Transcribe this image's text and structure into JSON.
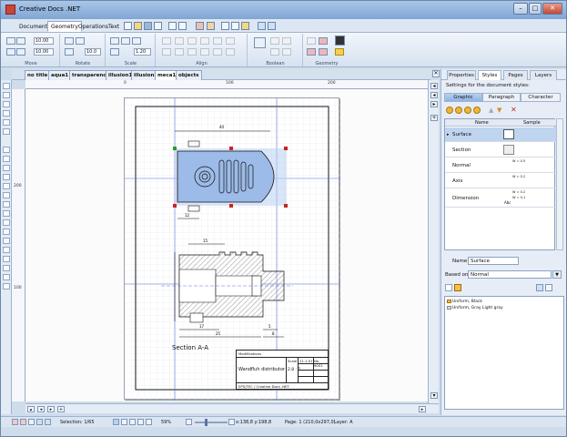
{
  "app": {
    "title": "Creative Docs .NET"
  },
  "titlebar": {
    "minimize": "–",
    "maximize": "□",
    "close": "✕"
  },
  "menu_tabs": [
    "Documents",
    "Geometry",
    "Operations",
    "Text"
  ],
  "ribbon": {
    "groups": [
      "Move",
      "Rotate",
      "Scale",
      "Align",
      "Boolean",
      "Geometry"
    ],
    "move_x": "10.00",
    "move_y": "10.00",
    "rotate_val": "10.0",
    "scale_val": "1.20"
  },
  "doc_tabs": [
    "no title",
    "aqua1",
    "transparency",
    "illusion1",
    "illusion2",
    "meca1",
    "objects"
  ],
  "ruler": {
    "top": [
      "0",
      "100",
      "200"
    ],
    "left": [
      "200",
      "100"
    ]
  },
  "drawing": {
    "dims": [
      "40",
      "12",
      "15",
      "17",
      "25",
      "5",
      "8"
    ],
    "section_label": "Section A-A",
    "title_block": {
      "modifications": "Modifications",
      "name": "Wandfluh distributor",
      "scale_label": "Scale",
      "scale_val": "2.8 : 1",
      "company": "EPS/TEC / Creative Docs .NET",
      "date": "21.1.01",
      "no": "No 9001"
    }
  },
  "panel": {
    "tabs": [
      "Properties",
      "Styles",
      "Pages",
      "Layers"
    ],
    "settings_title": "Settings for the document styles:",
    "subtabs": [
      "Graphic",
      "Paragraph",
      "Character"
    ],
    "grid_headers": [
      "Name",
      "Sample"
    ],
    "styles": [
      {
        "name": "Surface"
      },
      {
        "name": "Section"
      },
      {
        "name": "Normal",
        "sample": "W = 0.5"
      },
      {
        "name": "Axis",
        "sample": "W = 0.2"
      },
      {
        "name": "Dimension",
        "sample": "W = 0.2",
        "sample2": "W = 0.1",
        "sample3": "Abc"
      }
    ],
    "name_label": "Name",
    "name_value": "Surface",
    "based_on_label": "Based on",
    "based_on_value": "Normal",
    "descriptions": [
      "Uniform, Black",
      "Uniform, Gray Light gray"
    ]
  },
  "status": {
    "selection": "Selection: 1/65",
    "zoom": "59%",
    "coords": "x:138,8 y:198,8",
    "page": "Page: 1 (210,0x297,0)",
    "layer": "Layer: A"
  },
  "colors": {
    "accent": "#8fb4e4",
    "selection": "#b9d1f3",
    "guide": "#5a6fd8"
  }
}
